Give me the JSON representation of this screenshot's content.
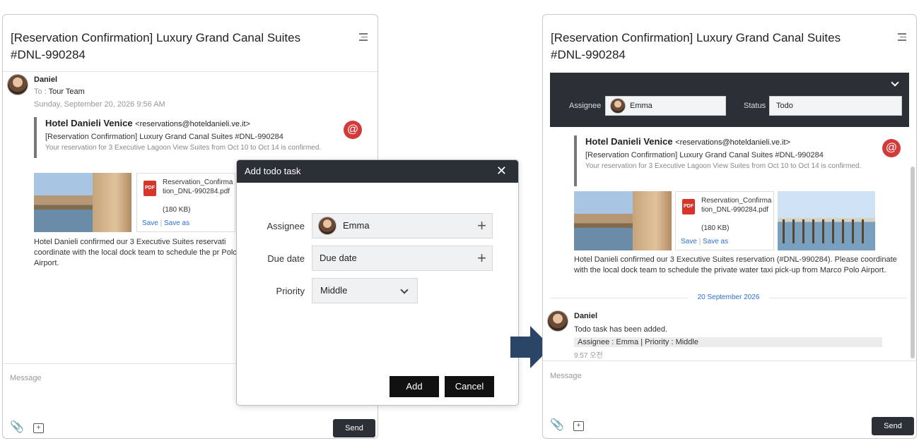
{
  "title": "[Reservation Confirmation] Luxury Grand Canal Suites #DNL-990284",
  "message": {
    "sender": "Daniel",
    "to_label": "To :",
    "to_value": "Tour Team",
    "timestamp": "Sunday, September 20, 2026 9:56 AM",
    "quote_name": "Hotel Danieli Venice",
    "quote_email": "<reservations@hoteldanieli.ve.it>",
    "quote_subject": "[Reservation Confirmation] Luxury Grand Canal Suites #DNL-990284",
    "quote_preview": "Your reservation for 3 Executive Lagoon View Suites from Oct 10 to Oct 14 is confirmed.",
    "at_symbol": "@",
    "attachment": {
      "type_label": "PDF",
      "name": "Reservation_Confirmation_DNL-990284.pdf",
      "size": "(180 KB)",
      "save": "Save",
      "separator": "|",
      "save_as": "Save as"
    },
    "body_left": "Hotel Danieli confirmed our 3 Executive Suites reservati coordinate with the local dock team to schedule the pr Polo Airport.",
    "body_right": "Hotel Danieli confirmed our 3 Executive Suites reservation (#DNL-990284). Please coordinate with the local dock team to schedule the private water taxi pick-up from Marco Polo Airport."
  },
  "composer": {
    "placeholder": "Message",
    "send": "Send"
  },
  "modal": {
    "title": "Add todo task",
    "close": "✕",
    "assignee_label": "Assignee",
    "assignee_value": "Emma",
    "due_label": "Due date",
    "due_value": "Due date",
    "priority_label": "Priority",
    "priority_value": "Middle",
    "plus": "+",
    "add": "Add",
    "cancel": "Cancel"
  },
  "filter": {
    "assignee_label": "Assignee",
    "assignee_value": "Emma",
    "status_label": "Status",
    "status_value": "Todo"
  },
  "thread": {
    "date_separator": "20 September 2026",
    "sender": "Daniel",
    "system_message": "Todo task has been added.",
    "system_detail": "Assignee : Emma | Priority : Middle",
    "system_time": "9:57 오전"
  },
  "colors": {
    "dark": "#2b2f36",
    "accent_red": "#d33a3a",
    "link_blue": "#2c6fd1",
    "arrow": "#2a4566"
  },
  "icons": [
    "menu-icon",
    "at-icon",
    "pdf-icon",
    "paperclip-icon",
    "image-add-icon",
    "close-icon",
    "plus-icon",
    "chevron-down-icon",
    "arrow-right-icon"
  ]
}
